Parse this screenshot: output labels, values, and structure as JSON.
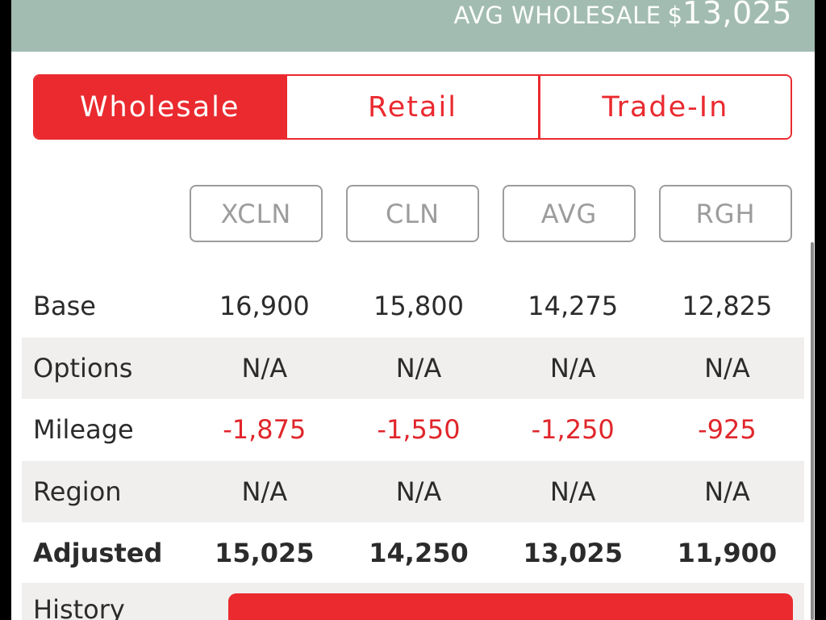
{
  "header": {
    "label": "AVG WHOLESALE",
    "currency": "$",
    "value": "13,025",
    "background": "#a2bcb1"
  },
  "tabs": [
    {
      "label": "Wholesale",
      "active": true
    },
    {
      "label": "Retail",
      "active": false
    },
    {
      "label": "Trade-In",
      "active": false
    }
  ],
  "conditions": [
    "XCLN",
    "CLN",
    "AVG",
    "RGH"
  ],
  "rows": [
    {
      "label": "Base",
      "values": [
        "16,900",
        "15,800",
        "14,275",
        "12,825"
      ]
    },
    {
      "label": "Options",
      "values": [
        "N/A",
        "N/A",
        "N/A",
        "N/A"
      ]
    },
    {
      "label": "Mileage",
      "values": [
        "-1,875",
        "-1,550",
        "-1,250",
        "-925"
      ]
    },
    {
      "label": "Region",
      "values": [
        "N/A",
        "N/A",
        "N/A",
        "N/A"
      ]
    },
    {
      "label": "Adjusted",
      "values": [
        "15,025",
        "14,250",
        "13,025",
        "11,900"
      ]
    }
  ],
  "history": {
    "label": "History"
  },
  "colors": {
    "accent": "#ea2a2f",
    "negative": "#e0262b",
    "shaded_row": "#f0efed",
    "condition_border": "#9c9c9c"
  }
}
